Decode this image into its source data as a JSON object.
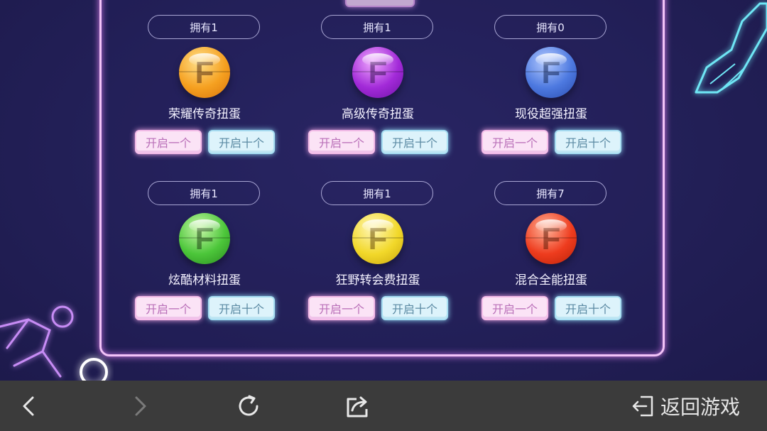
{
  "gacha": [
    {
      "owned": "拥有1",
      "name": "荣耀传奇扭蛋",
      "open_one": "开启一个",
      "open_ten": "开启十个",
      "color": "#f5a020",
      "ball_letter": "F"
    },
    {
      "owned": "拥有1",
      "name": "高级传奇扭蛋",
      "open_one": "开启一个",
      "open_ten": "开启十个",
      "color": "#a22ad8",
      "ball_letter": "F"
    },
    {
      "owned": "拥有0",
      "name": "现役超强扭蛋",
      "open_one": "开启一个",
      "open_ten": "开启十个",
      "color": "#4d79e0",
      "ball_letter": "F"
    },
    {
      "owned": "拥有1",
      "name": "炫酷材料扭蛋",
      "open_one": "开启一个",
      "open_ten": "开启十个",
      "color": "#4cc63a",
      "ball_letter": "F"
    },
    {
      "owned": "拥有1",
      "name": "狂野转会费扭蛋",
      "open_one": "开启一个",
      "open_ten": "开启十个",
      "color": "#f2d82a",
      "ball_letter": "F"
    },
    {
      "owned": "拥有7",
      "name": "混合全能扭蛋",
      "open_one": "开启一个",
      "open_ten": "开启十个",
      "color": "#ee3c1e",
      "ball_letter": "F"
    }
  ],
  "bottom_bar": {
    "back_icon": "chevron-left-icon",
    "forward_icon": "chevron-right-icon",
    "refresh_icon": "refresh-icon",
    "share_icon": "share-icon",
    "return_icon": "exit-icon",
    "return_label": "返回游戏"
  },
  "colors": {
    "background": "#24215a",
    "panel_border": "#f2c3f8",
    "bottom_bar": "#3b3b3b"
  }
}
